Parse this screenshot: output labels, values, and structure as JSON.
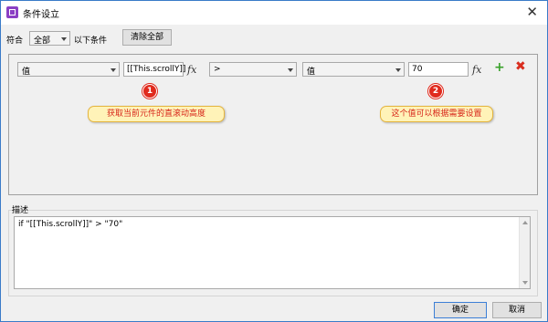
{
  "window": {
    "title": "条件设立",
    "close_glyph": "✕"
  },
  "toolbar": {
    "match_label": "符合",
    "match_value": "全部",
    "suffix_label": "以下条件",
    "clear_all_label": "清除全部"
  },
  "condition": {
    "left_type": "值",
    "left_value": "[[This.scrollY]]",
    "operator": ">",
    "right_type": "值",
    "right_value": "70",
    "fx_label": "fx",
    "add_glyph": "+",
    "remove_glyph": "✖"
  },
  "annotations": [
    {
      "number": "1",
      "text": "获取当前元件的直滚动高度"
    },
    {
      "number": "2",
      "text": "这个值可以根据需要设置"
    }
  ],
  "description": {
    "label": "描述",
    "text": "if \"[[This.scrollY]]\" > \"70\""
  },
  "footer": {
    "ok_label": "确定",
    "cancel_label": "取消"
  },
  "colors": {
    "accent": "#3c7fd6",
    "badge": "#e02a1d",
    "callout_fill": "#fff3b8",
    "add": "#3aa12b",
    "remove": "#d92d1e"
  }
}
